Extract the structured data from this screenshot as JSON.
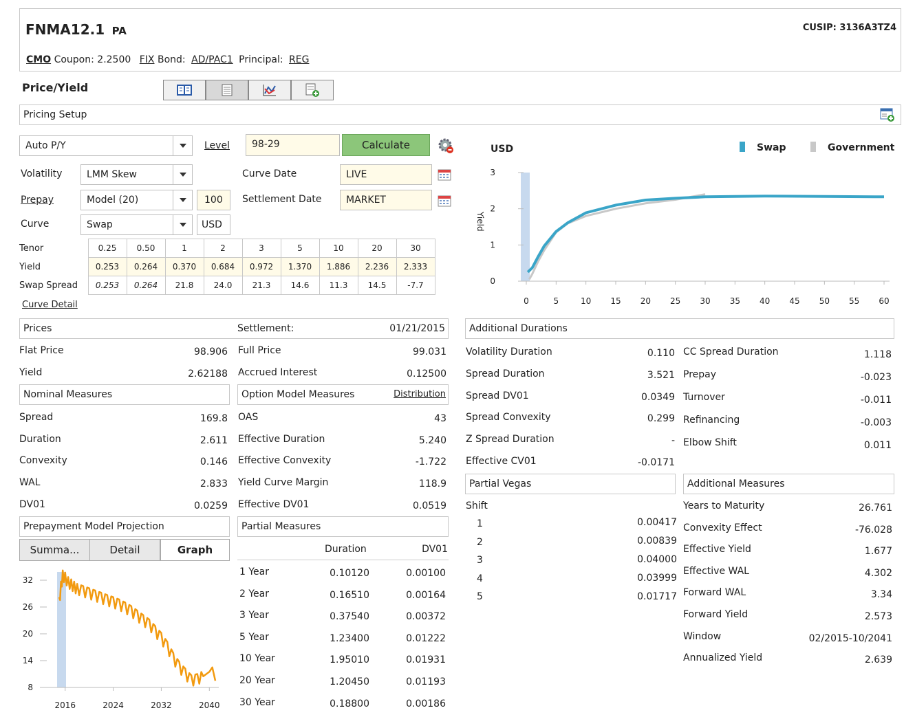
{
  "header": {
    "ticker": "FNMA12.1",
    "ticker_suffix": "PA",
    "cusip": "CUSIP: 3136A3TZ4",
    "type_label": "CMO",
    "coupon_label": "Coupon:",
    "coupon_value": "2.2500",
    "fix_label": "FIX",
    "bond_label": "Bond:",
    "bond_value": "AD/PAC1",
    "principal_label": "Principal:",
    "principal_value": "REG"
  },
  "toolbar": {
    "title": "Price/Yield",
    "buttons": [
      "book-icon",
      "table-icon",
      "chart-icon",
      "calculator-add-icon"
    ]
  },
  "pricing_setup": {
    "label": "Pricing Setup"
  },
  "setup": {
    "mode_value": "Auto P/Y",
    "level_label": "Level",
    "level_value": "98-29",
    "calculate_label": "Calculate",
    "volatility_label": "Volatility",
    "volatility_value": "LMM Skew",
    "prepay_label": "Prepay",
    "prepay_value": "Model (20)",
    "prepay_speed": "100",
    "curve_label": "Curve",
    "curve_value": "Swap",
    "currency": "USD",
    "curve_date_label": "Curve Date",
    "curve_date_value": "LIVE",
    "settlement_date_label": "Settlement Date",
    "settlement_date_value": "MARKET",
    "curve_detail_label": "Curve Detail"
  },
  "tenor_table": {
    "tenor_label": "Tenor",
    "yield_label": "Yield",
    "spread_label": "Swap Spread",
    "tenors": [
      "0.25",
      "0.50",
      "1",
      "2",
      "3",
      "5",
      "10",
      "20",
      "30"
    ],
    "yields": [
      "0.253",
      "0.264",
      "0.370",
      "0.684",
      "0.972",
      "1.370",
      "1.886",
      "2.236",
      "2.333"
    ],
    "spreads": [
      "0.253",
      "0.264",
      "21.8",
      "24.0",
      "21.3",
      "14.6",
      "11.3",
      "14.5",
      "-7.7"
    ]
  },
  "prices": {
    "title": "Prices",
    "settlement_label": "Settlement:",
    "settlement_value": "01/21/2015",
    "flat_price_label": "Flat Price",
    "flat_price": "98.906",
    "full_price_label": "Full Price",
    "full_price": "99.031",
    "yield_label": "Yield",
    "yield": "2.62188",
    "accrued_label": "Accrued Interest",
    "accrued": "0.12500"
  },
  "nominal": {
    "title": "Nominal Measures",
    "rows": [
      {
        "label": "Spread",
        "value": "169.8"
      },
      {
        "label": "Duration",
        "value": "2.611"
      },
      {
        "label": "Convexity",
        "value": "0.146"
      },
      {
        "label": "WAL",
        "value": "2.833"
      },
      {
        "label": "DV01",
        "value": "0.0259"
      }
    ]
  },
  "option_model": {
    "title": "Option Model Measures",
    "distribution_label": "Distribution",
    "rows": [
      {
        "label": "OAS",
        "value": "43"
      },
      {
        "label": "Effective Duration",
        "value": "5.240"
      },
      {
        "label": "Effective Convexity",
        "value": "-1.722"
      },
      {
        "label": "Yield Curve Margin",
        "value": "118.9"
      },
      {
        "label": "Effective DV01",
        "value": "0.0519"
      }
    ]
  },
  "prepayment": {
    "title": "Prepayment Model Projection",
    "tabs": [
      "Summa...",
      "Detail",
      "Graph"
    ]
  },
  "partial": {
    "title": "Partial Measures",
    "col_duration": "Duration",
    "col_dv01": "DV01",
    "rows": [
      {
        "label": "1 Year",
        "duration": "0.10120",
        "dv01": "0.00100"
      },
      {
        "label": "2 Year",
        "duration": "0.16510",
        "dv01": "0.00164"
      },
      {
        "label": "3 Year",
        "duration": "0.37540",
        "dv01": "0.00372"
      },
      {
        "label": "5 Year",
        "duration": "1.23400",
        "dv01": "0.01222"
      },
      {
        "label": "10 Year",
        "duration": "1.95010",
        "dv01": "0.01931"
      },
      {
        "label": "20 Year",
        "duration": "1.20450",
        "dv01": "0.01193"
      },
      {
        "label": "30 Year",
        "duration": "0.18800",
        "dv01": "0.00186"
      }
    ]
  },
  "additional_durations": {
    "title": "Additional Durations",
    "left": [
      {
        "label": "Volatility Duration",
        "value": "0.110"
      },
      {
        "label": "Spread Duration",
        "value": "3.521"
      },
      {
        "label": "Spread DV01",
        "value": "0.0349"
      },
      {
        "label": "Spread Convexity",
        "value": "0.299"
      },
      {
        "label": "Z Spread Duration",
        "value": "-"
      },
      {
        "label": "Effective CV01",
        "value": "-0.0171"
      }
    ],
    "right": [
      {
        "label": "CC Spread Duration",
        "value": "1.118"
      },
      {
        "label": "Prepay",
        "value": "-0.023"
      },
      {
        "label": "Turnover",
        "value": "-0.011"
      },
      {
        "label": "Refinancing",
        "value": "-0.003"
      },
      {
        "label": "Elbow Shift",
        "value": "0.011"
      }
    ]
  },
  "partial_vegas": {
    "title": "Partial Vegas",
    "shift_label": "Shift",
    "rows": [
      {
        "label": "1",
        "value": "0.00417"
      },
      {
        "label": "2",
        "value": "0.00839"
      },
      {
        "label": "3",
        "value": "0.04000"
      },
      {
        "label": "4",
        "value": "0.03999"
      },
      {
        "label": "5",
        "value": "0.01717"
      }
    ]
  },
  "additional_measures": {
    "title": "Additional Measures",
    "rows": [
      {
        "label": "Years to Maturity",
        "value": "26.761"
      },
      {
        "label": "Convexity Effect",
        "value": "-76.028"
      },
      {
        "label": "Effective Yield",
        "value": "1.677"
      },
      {
        "label": "Effective WAL",
        "value": "4.302"
      },
      {
        "label": "Forward WAL",
        "value": "3.34"
      },
      {
        "label": "Forward Yield",
        "value": "2.573"
      },
      {
        "label": "Window",
        "value": "02/2015-10/2041"
      },
      {
        "label": "Annualized Yield",
        "value": "2.639"
      }
    ]
  },
  "colors": {
    "swap": "#3aa5c8",
    "government": "#c8c8c8",
    "prepay_line": "#f29a0f",
    "calculate_bg": "#8cc67a",
    "band": "#c7d9ee"
  },
  "chart_data": [
    {
      "type": "line",
      "title": "USD",
      "ylabel": "Yield",
      "xlabel": "",
      "xlim": [
        0,
        60
      ],
      "ylim": [
        0,
        3
      ],
      "x_ticks": [
        "0",
        "5",
        "10",
        "15",
        "20",
        "25",
        "30",
        "35",
        "40",
        "45",
        "50",
        "55",
        "60"
      ],
      "y_ticks": [
        "0",
        "1",
        "2",
        "3"
      ],
      "legend_position": "top-right",
      "series": [
        {
          "name": "Swap",
          "x": [
            0.25,
            1,
            2,
            3,
            5,
            7,
            10,
            15,
            20,
            25,
            30,
            40,
            50,
            60
          ],
          "y": [
            0.25,
            0.37,
            0.68,
            0.97,
            1.37,
            1.62,
            1.89,
            2.1,
            2.24,
            2.29,
            2.33,
            2.35,
            2.34,
            2.33
          ]
        },
        {
          "name": "Government",
          "x": [
            0.5,
            1,
            2,
            3,
            5,
            7,
            10,
            15,
            20,
            25,
            30
          ],
          "y": [
            0.05,
            0.2,
            0.55,
            0.85,
            1.35,
            1.6,
            1.8,
            2.0,
            2.15,
            2.25,
            2.4
          ]
        }
      ]
    },
    {
      "type": "line",
      "title": "",
      "xlim": [
        2015,
        2041
      ],
      "ylim": [
        8,
        32
      ],
      "x_ticks": [
        "2016",
        "2024",
        "2032",
        "2040"
      ],
      "y_ticks": [
        "32",
        "26",
        "20",
        "14",
        "8"
      ],
      "series": [
        {
          "name": "",
          "x": [
            2015.0,
            2015.3,
            2015.6,
            2016.0,
            2016.5,
            2017.0,
            2017.5,
            2018.0,
            2019.0,
            2020.0,
            2021.0,
            2022.0,
            2023.0,
            2024.0,
            2025.0,
            2026.0,
            2027.0,
            2028.0,
            2029.0,
            2030.0,
            2031.0,
            2032.0,
            2033.0,
            2034.0,
            2035.0,
            2036.0,
            2037.0,
            2038.0,
            2039.0,
            2040.0,
            2040.5,
            2041.0
          ],
          "y": [
            27.0,
            30.5,
            33.0,
            32.5,
            31.5,
            31.0,
            30.5,
            30.0,
            29.5,
            29.0,
            28.5,
            28.0,
            27.5,
            27.0,
            26.5,
            25.8,
            25.0,
            24.0,
            23.0,
            22.0,
            20.5,
            19.0,
            17.0,
            14.5,
            12.5,
            11.0,
            9.5,
            9.8,
            10.5,
            11.5,
            12.5,
            9.5
          ]
        }
      ]
    }
  ]
}
